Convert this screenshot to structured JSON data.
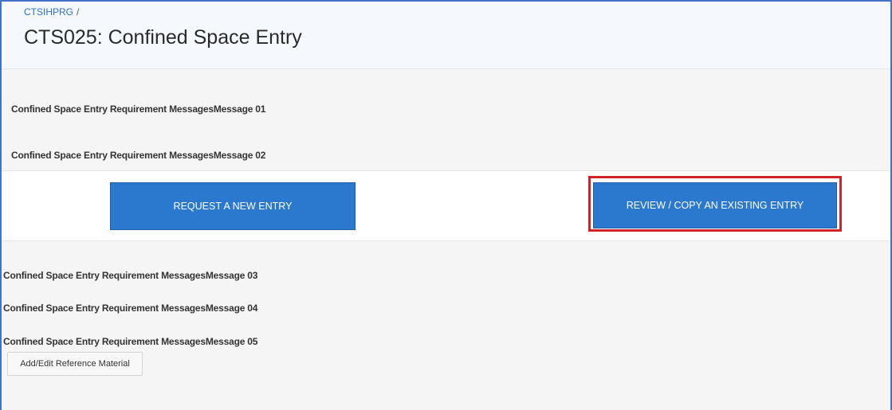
{
  "breadcrumb": {
    "root": "CTSIHPRG",
    "separator": "/"
  },
  "page_title": "CTS025: Confined Space Entry",
  "messages": [
    "Confined Space Entry Requirement MessagesMessage 01",
    "Confined Space Entry Requirement MessagesMessage 02",
    "Confined Space Entry Requirement MessagesMessage 03",
    "Confined Space Entry Requirement MessagesMessage 04",
    "Confined Space Entry Requirement MessagesMessage 05"
  ],
  "actions": {
    "request_new_label": "REQUEST A NEW ENTRY",
    "review_copy_label": "REVIEW / COPY AN EXISTING ENTRY"
  },
  "reference_button_label": "Add/Edit Reference Material",
  "colors": {
    "primary_button": "#2b78cf",
    "highlight_border": "#d0232a",
    "frame_border": "#4472c4"
  }
}
